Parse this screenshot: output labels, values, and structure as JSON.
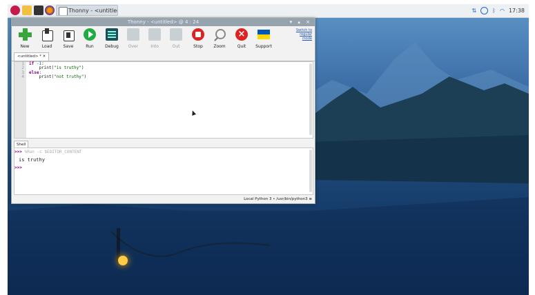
{
  "taskbar": {
    "task_label": "Thonny - <untitled>",
    "clock": "17:38",
    "icons": [
      "raspberry-icon",
      "file-manager-icon",
      "terminal-icon",
      "browser-icon"
    ],
    "tray_icons": [
      "network-transfer-icon",
      "update-icon",
      "bluetooth-icon",
      "wifi-icon"
    ]
  },
  "window": {
    "title": "Thonny - <untitled> @ 4 : 24",
    "controls": "▾ ▴ ×"
  },
  "toolbar": {
    "buttons": [
      {
        "label": "New",
        "icon": "new-plus-icon",
        "enabled": true
      },
      {
        "label": "Load",
        "icon": "load-icon",
        "enabled": true
      },
      {
        "label": "Save",
        "icon": "save-icon",
        "enabled": true
      },
      {
        "label": "Run",
        "icon": "run-icon",
        "enabled": true
      },
      {
        "label": "Debug",
        "icon": "debug-icon",
        "enabled": true
      },
      {
        "label": "Over",
        "icon": "step-over-icon",
        "enabled": false
      },
      {
        "label": "Into",
        "icon": "step-into-icon",
        "enabled": false
      },
      {
        "label": "Out",
        "icon": "step-out-icon",
        "enabled": false
      },
      {
        "label": "Stop",
        "icon": "stop-icon",
        "enabled": true
      },
      {
        "label": "Zoom",
        "icon": "zoom-icon",
        "enabled": true
      },
      {
        "label": "Quit",
        "icon": "quit-icon",
        "enabled": true
      },
      {
        "label": "Support",
        "icon": "ukraine-flag-icon",
        "enabled": true
      }
    ],
    "switch_mode": [
      "Switch to",
      "regular",
      "mode"
    ]
  },
  "editor": {
    "tab_label": "<untitled> * ✕",
    "line_numbers": [
      "1",
      "2",
      "3",
      "4"
    ],
    "code": {
      "l1_kw": "if",
      "l1_num": " -1",
      "l1_end": ":",
      "l2_indent": "    print(",
      "l2_str": "\"is truthy\"",
      "l2_end": ")",
      "l3_kw": "else",
      "l3_end": ":",
      "l4_indent": "    print(",
      "l4_str": "\"not truthy\"",
      "l4_end": ")"
    }
  },
  "shell": {
    "tab_label": "Shell",
    "prompt": ">>>",
    "run_command": " %Run -c $EDITOR_CONTENT",
    "output": "is truthy"
  },
  "status": {
    "interpreter": "Local Python 3 • /usr/bin/python3 ≡"
  },
  "colors": {
    "new_green": "#3aa53a",
    "run_green": "#22aa44",
    "stop_red": "#dd2222",
    "quit_red": "#dd2222",
    "flag_blue": "#0057b7",
    "flag_yellow": "#ffd700"
  }
}
